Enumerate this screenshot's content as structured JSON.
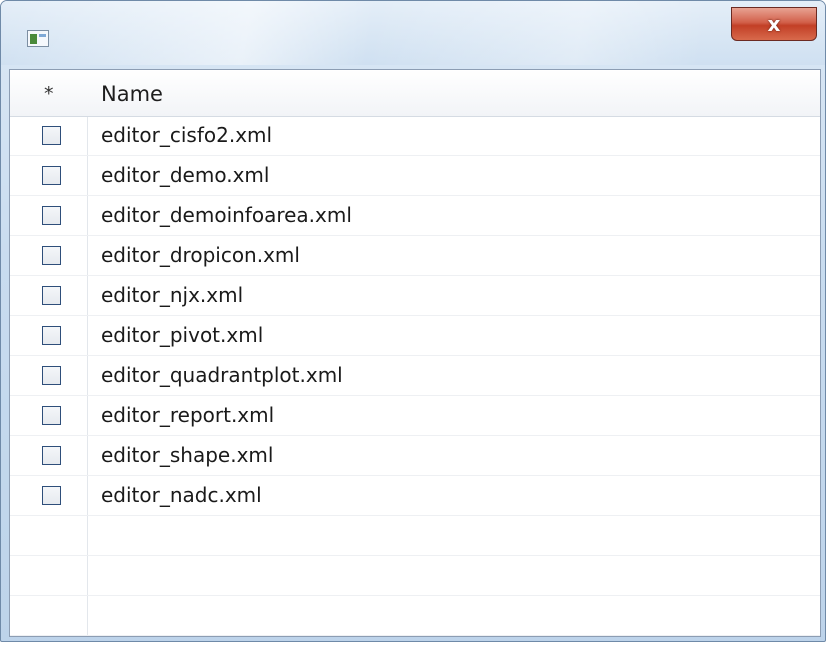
{
  "window": {
    "close_glyph": "x",
    "app_icon": "window-app-icon"
  },
  "table": {
    "headers": {
      "check": "*",
      "name": "Name"
    },
    "rows": [
      {
        "name": "editor_cisfo2.xml",
        "checked": false
      },
      {
        "name": "editor_demo.xml",
        "checked": false
      },
      {
        "name": "editor_demoinfoarea.xml",
        "checked": false
      },
      {
        "name": "editor_dropicon.xml",
        "checked": false
      },
      {
        "name": "editor_njx.xml",
        "checked": false
      },
      {
        "name": "editor_pivot.xml",
        "checked": false
      },
      {
        "name": "editor_quadrantplot.xml",
        "checked": false
      },
      {
        "name": "editor_report.xml",
        "checked": false
      },
      {
        "name": "editor_shape.xml",
        "checked": false
      },
      {
        "name": "editor_nadc.xml",
        "checked": false
      }
    ]
  },
  "colors": {
    "close_button": "#c94a30",
    "titlebar": "#cfe0f1",
    "checkbox_border": "#2e4e7a"
  }
}
